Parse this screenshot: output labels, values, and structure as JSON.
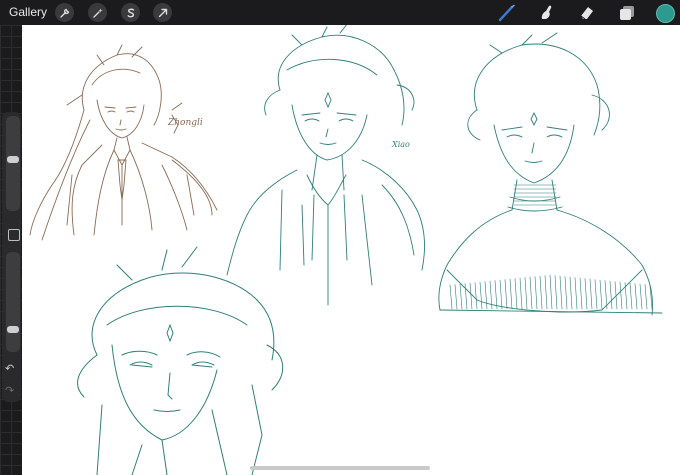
{
  "toolbar": {
    "gallery_label": "Gallery",
    "actions": [
      {
        "name": "wrench-icon"
      },
      {
        "name": "magic-wand-icon"
      },
      {
        "name": "selection-s-icon"
      },
      {
        "name": "transform-arrow-icon"
      }
    ],
    "tools": [
      {
        "name": "brush-icon",
        "active": true
      },
      {
        "name": "smudge-icon",
        "active": false
      },
      {
        "name": "eraser-icon",
        "active": false
      },
      {
        "name": "layers-icon",
        "active": false
      }
    ],
    "active_color": "#2e9a8f"
  },
  "sidebar": {
    "brush_size_level": 0.55,
    "opacity_level": 0.2
  },
  "canvas": {
    "sketches": [
      {
        "name": "zhongli",
        "signature": "Zhongli",
        "ink": "#8a6a55"
      },
      {
        "name": "xiao",
        "signature": "Xiao",
        "ink": "#2f7f78"
      },
      {
        "name": "bust-right",
        "ink": "#2f7f78"
      },
      {
        "name": "face-closeup",
        "ink": "#2f7f78"
      }
    ]
  },
  "colors": {
    "toolbar_bg": "#1b1b1d",
    "accent": "#2e9a8f",
    "brush_blue": "#3a7bd5"
  }
}
